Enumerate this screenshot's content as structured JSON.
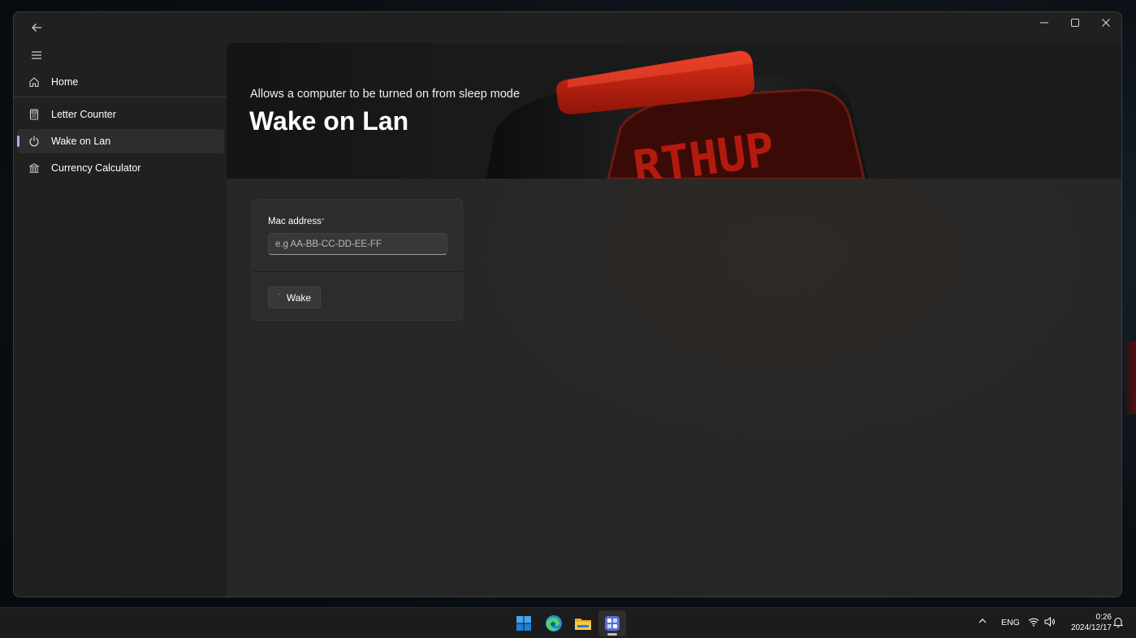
{
  "sidebar": {
    "items": [
      {
        "label": "Home",
        "icon": "home-icon"
      },
      {
        "label": "Letter Counter",
        "icon": "calculator-icon"
      },
      {
        "label": "Wake on Lan",
        "icon": "power-icon"
      },
      {
        "label": "Currency Calculator",
        "icon": "bank-icon"
      }
    ],
    "selected": "Wake on Lan",
    "accent": "#b9a8ff"
  },
  "hero": {
    "subtitle": "Allows a computer to be turned on from sleep mode",
    "title": "Wake on Lan"
  },
  "form": {
    "mac_label": "Mac address",
    "required_mark": "*",
    "mac_placeholder": "e.g AA-BB-CC-DD-EE-FF",
    "mac_value": "",
    "wake_label": "Wake"
  },
  "taskbar": {
    "apps": [
      "windows-start-icon",
      "edge-browser-icon",
      "file-explorer-icon",
      "toolbox-app-icon"
    ],
    "language": "ENG",
    "time": "0:26",
    "date": "2024/12/17"
  }
}
